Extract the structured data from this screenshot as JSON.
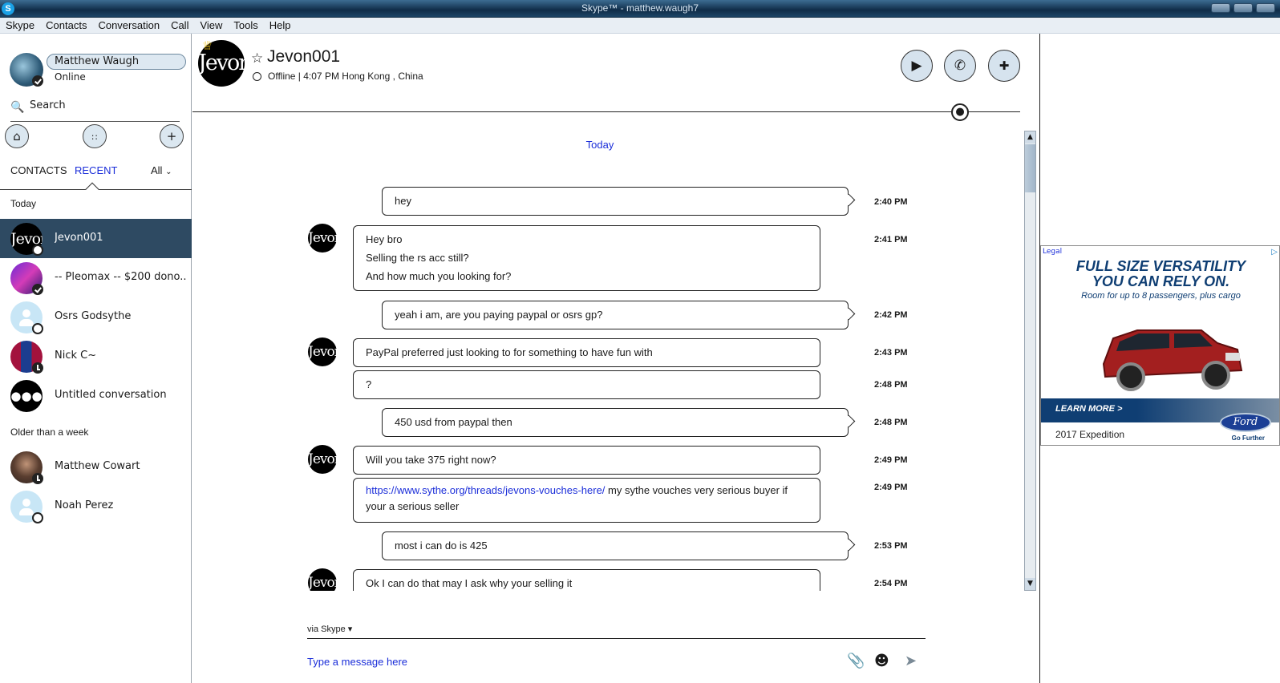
{
  "window": {
    "title": "Skype™ - matthew.waugh7"
  },
  "menu": [
    "Skype",
    "Contacts",
    "Conversation",
    "Call",
    "View",
    "Tools",
    "Help"
  ],
  "profile": {
    "name": "Matthew Waugh",
    "status": "Online"
  },
  "search": {
    "label": "Search"
  },
  "tabs": {
    "contacts": "CONTACTS",
    "recent": "RECENT",
    "filter": "All"
  },
  "sections": {
    "today": "Today",
    "older": "Older than a week"
  },
  "contacts": [
    {
      "name": "Jevon001",
      "avatar_text": "Jevon"
    },
    {
      "name": "-- Pleomax -- $200 dono..."
    },
    {
      "name": "Osrs Godsythe"
    },
    {
      "name": "Nick C~"
    },
    {
      "name": "Untitled conversation"
    },
    {
      "name": "Matthew Cowart"
    },
    {
      "name": "Noah Perez"
    }
  ],
  "chat": {
    "title": "Jevon001",
    "subtitle": "Offline  |  4:07 PM Hong Kong , China",
    "day_label": "Today"
  },
  "messages": [
    {
      "lines": [
        "hey"
      ],
      "time": "2:40 PM"
    },
    {
      "lines": [
        "Hey bro",
        "Selling the rs acc still?",
        "And how much you looking for?"
      ],
      "time": "2:41 PM"
    },
    {
      "lines": [
        "yeah i am, are you paying paypal or osrs gp?"
      ],
      "time": "2:42 PM"
    },
    {
      "lines": [
        "PayPal preferred just looking to for something to have fun with"
      ],
      "time": "2:43 PM"
    },
    {
      "lines": [
        "?"
      ],
      "time": "2:48 PM"
    },
    {
      "lines": [
        "450 usd from paypal then"
      ],
      "time": "2:48 PM"
    },
    {
      "lines": [
        "Will you take 375 right now?"
      ],
      "time": "2:49 PM"
    },
    {
      "link": "https://www.sythe.org/threads/jevons-vouches-here/",
      "rest": " my sythe vouches very serious buyer if",
      "line2": "your a serious seller",
      "time": "2:49 PM"
    },
    {
      "lines": [
        "most i can do is 425"
      ],
      "time": "2:53 PM"
    },
    {
      "lines": [
        "Ok I can do that may I ask why your selling it"
      ],
      "time": "2:54 PM"
    }
  ],
  "composer": {
    "via": "via Skype",
    "placeholder": "Type a message here"
  },
  "ad": {
    "legal": "Legal",
    "headline1": "FULL SIZE VERSATILITY",
    "headline2": "YOU CAN RELY ON.",
    "sub": "Room for up to 8 passengers, plus cargo",
    "cta": "LEARN MORE >",
    "model": "2017 Expedition",
    "brand": "Ford",
    "tagline": "Go Further"
  },
  "colors": {
    "accent": "#1b2ed9",
    "active_row": "#2e4a62",
    "titlebar": "#0f2c48"
  }
}
